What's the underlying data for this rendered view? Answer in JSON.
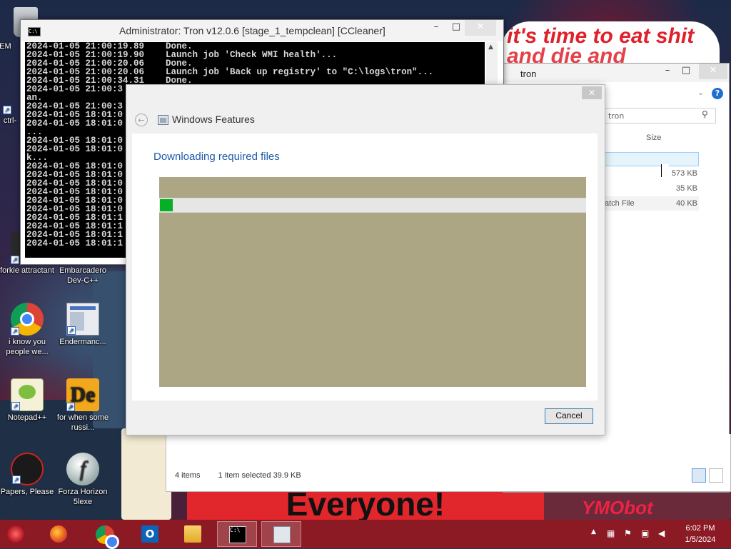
{
  "console": {
    "title": "Administrator:  Tron v12.0.6 [stage_1_tempclean] [CCleaner]",
    "icon_label": "C:\\",
    "lines": [
      "2024-01-05 21:00:19.89    Done.",
      "2024-01-05 21:00:19.90    Launch job 'Check WMI health'...",
      "2024-01-05 21:00:20.06    Done.",
      "2024-01-05 21:00:20.06    Launch job 'Back up registry' to \"C:\\logs\\tron\"...",
      "2024-01-05 21:00:34.31    Done.",
      "2024-01-05 21:00:3",
      "an.",
      "2024-01-05 21:00:3",
      "2024-01-05 18:01:0",
      "2024-01-05 18:01:0",
      "...",
      "2024-01-05 18:01:0",
      "2024-01-05 18:01:0",
      "k...",
      "2024-01-05 18:01:0",
      "2024-01-05 18:01:0",
      "2024-01-05 18:01:0",
      "2024-01-05 18:01:0",
      "2024-01-05 18:01:0",
      "2024-01-05 18:01:0",
      "2024-01-05 18:01:1",
      "2024-01-05 18:01:1",
      "2024-01-05 18:01:1",
      "2024-01-05 18:01:1"
    ]
  },
  "explorer": {
    "title": "tron",
    "search_placeholder": "tron",
    "column_size": "Size",
    "rows": [
      {
        "name": "",
        "size": ""
      },
      {
        "name": "",
        "size": "573 KB"
      },
      {
        "name": "",
        "size": "35 KB"
      },
      {
        "name": "atch File",
        "size": "40 KB"
      }
    ],
    "status": {
      "items": "4 items",
      "selected": "1 item selected  39.9 KB"
    }
  },
  "dialog": {
    "title": "Windows Features",
    "heading": "Downloading required files",
    "cancel_label": "Cancel",
    "progress": 0.03,
    "progress_color": "#06b025"
  },
  "desktop": {
    "banner_top": "it's time to eat shit",
    "banner_top_line2": "and die and celebrate",
    "banner_bottom": "Everyone!",
    "wall_tag_right": "YMObot",
    "icons": [
      {
        "label": "MEM",
        "icon": "app-icon"
      },
      {
        "label": "ctrl-",
        "icon": "app-icon"
      },
      {
        "label": "forkie attractant",
        "icon": "app-icon"
      },
      {
        "label": "Embarcadero Dev-C++",
        "icon": "devcpp-icon"
      },
      {
        "label": "i know you people we...",
        "icon": "chrome-icon"
      },
      {
        "label": "Endermanc...",
        "icon": "window-icon"
      },
      {
        "label": "Notepad++",
        "icon": "notepadpp-icon"
      },
      {
        "label": "for when some russi...",
        "icon": "de-icon"
      },
      {
        "label": "Papers, Please",
        "icon": "papers-please-icon"
      },
      {
        "label": "Forza Horizon 5lexe",
        "icon": "flash-icon"
      }
    ]
  },
  "taskbar": {
    "start_icon": "start-orb-icon",
    "apps": [
      "firefox-icon",
      "chrome-icon",
      "outlook-icon",
      "file-explorer-icon",
      "cmd-icon",
      "windows-features-icon"
    ],
    "clock_time": "6:02 PM",
    "clock_date": "1/5/2024",
    "accent": "#8b1a24"
  }
}
